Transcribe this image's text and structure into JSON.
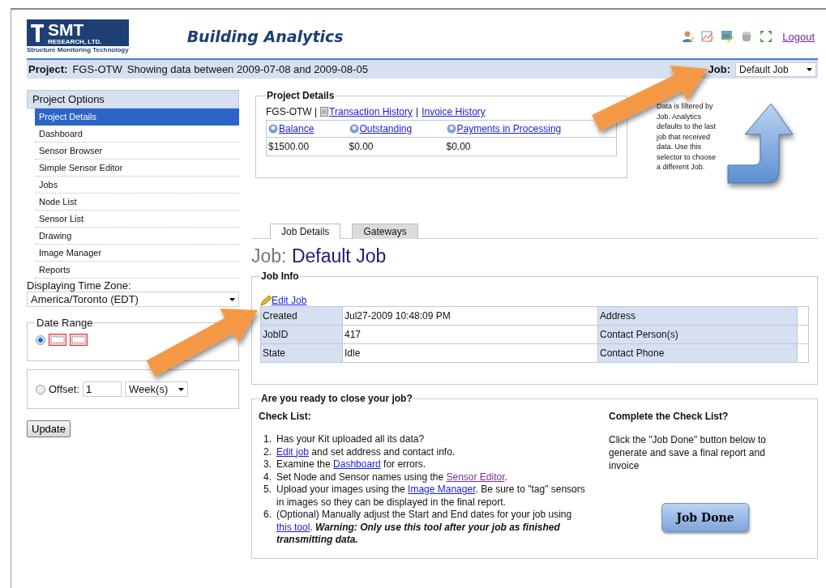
{
  "header": {
    "logo": {
      "name": "SMT",
      "sub": "RESEARCH, LTD.",
      "tagline": "Structure Monitoring Technology"
    },
    "title": "Building Analytics",
    "logout": "Logout"
  },
  "project_bar": {
    "label": "Project:",
    "project": "FGS-OTW",
    "range": "Showing data between 2009-07-08 and 2009-08-05",
    "job_label": "Job:",
    "job_value": "Default Job"
  },
  "sidebar": {
    "title": "Project Options",
    "items": [
      {
        "label": "Project Details",
        "selected": true
      },
      {
        "label": "Dashboard",
        "selected": false
      },
      {
        "label": "Sensor Browser",
        "selected": false
      },
      {
        "label": "Simple Sensor Editor",
        "selected": false
      },
      {
        "label": "Jobs",
        "selected": false
      },
      {
        "label": "Node List",
        "selected": false
      },
      {
        "label": "Sensor List",
        "selected": false
      },
      {
        "label": "Drawing",
        "selected": false
      },
      {
        "label": "Image Manager",
        "selected": false
      },
      {
        "label": "Reports",
        "selected": false
      }
    ],
    "timezone_label": "Displaying Time Zone:",
    "timezone_value": "America/Toronto (EDT)",
    "date_range": {
      "legend": "Date Range",
      "selected": true
    },
    "offset": {
      "selected": false,
      "label": "Offset:",
      "value": "1",
      "unit": "Week(s)"
    },
    "update_button": "Update"
  },
  "project_details": {
    "legend": "Project Details",
    "prefix": "FGS-OTW |",
    "links": [
      "Transaction History",
      "Invoice History"
    ],
    "separator": "|",
    "columns": [
      "Balance",
      "Outstanding",
      "Payments in Processing"
    ],
    "values": [
      "$1500.00",
      "$0.00",
      "$0.00"
    ]
  },
  "note": "Data is filtered by Job. Analytics defaults to the last job that received data. Use this selector to choose a different Job.",
  "tabs": [
    {
      "label": "Job Details",
      "selected": true
    },
    {
      "label": "Gateways",
      "selected": false
    }
  ],
  "job_heading": {
    "label": "Job:",
    "name": "Default Job"
  },
  "job_info": {
    "legend": "Job Info",
    "edit_link": "Edit Job",
    "rows": [
      {
        "label": "Created",
        "value": "Jul27-2009 10:48:09 PM",
        "label2": "Address"
      },
      {
        "label": "JobID",
        "value": "417",
        "label2": "Contact Person(s)"
      },
      {
        "label": "State",
        "value": "Idle",
        "label2": "Contact Phone"
      }
    ]
  },
  "close_job": {
    "legend": "Are you ready to close your job?",
    "checklist_title": "Check List:",
    "items": [
      {
        "number": "1.",
        "parts": [
          {
            "kind": "text",
            "text": "Has your Kit uploaded all its data?"
          }
        ]
      },
      {
        "number": "2.",
        "parts": [
          {
            "kind": "link",
            "text": "Edit job",
            "visited": false
          },
          {
            "kind": "text",
            "text": " and set address and contact info."
          }
        ]
      },
      {
        "number": "3.",
        "parts": [
          {
            "kind": "text",
            "text": "Examine the "
          },
          {
            "kind": "link",
            "text": "Dashboard",
            "visited": false
          },
          {
            "kind": "text",
            "text": " for errors."
          }
        ]
      },
      {
        "number": "4.",
        "parts": [
          {
            "kind": "text",
            "text": "Set Node and Sensor names using the "
          },
          {
            "kind": "link",
            "text": "Sensor Editor",
            "visited": true
          },
          {
            "kind": "text",
            "text": "."
          }
        ]
      },
      {
        "number": "5.",
        "parts": [
          {
            "kind": "text",
            "text": "Upload your images using the "
          },
          {
            "kind": "link",
            "text": "Image Manager",
            "visited": false
          },
          {
            "kind": "text",
            "text": ". Be sure to \"tag\" sensors in images so they can be displayed in the final report."
          }
        ]
      },
      {
        "number": "6.",
        "parts": [
          {
            "kind": "text",
            "text": "(Optional) Manually adjust the Start and End dates for your job using "
          },
          {
            "kind": "link",
            "text": "this tool",
            "visited": false
          },
          {
            "kind": "text",
            "text": ". "
          },
          {
            "kind": "warning",
            "text": "Warning: Only use this tool after your job as finished transmitting data."
          }
        ]
      }
    ],
    "complete_title": "Complete the Check List?",
    "complete_text": "Click the \"Job Done\" button below to generate and save a final report and invoice",
    "button": "Job Done"
  }
}
